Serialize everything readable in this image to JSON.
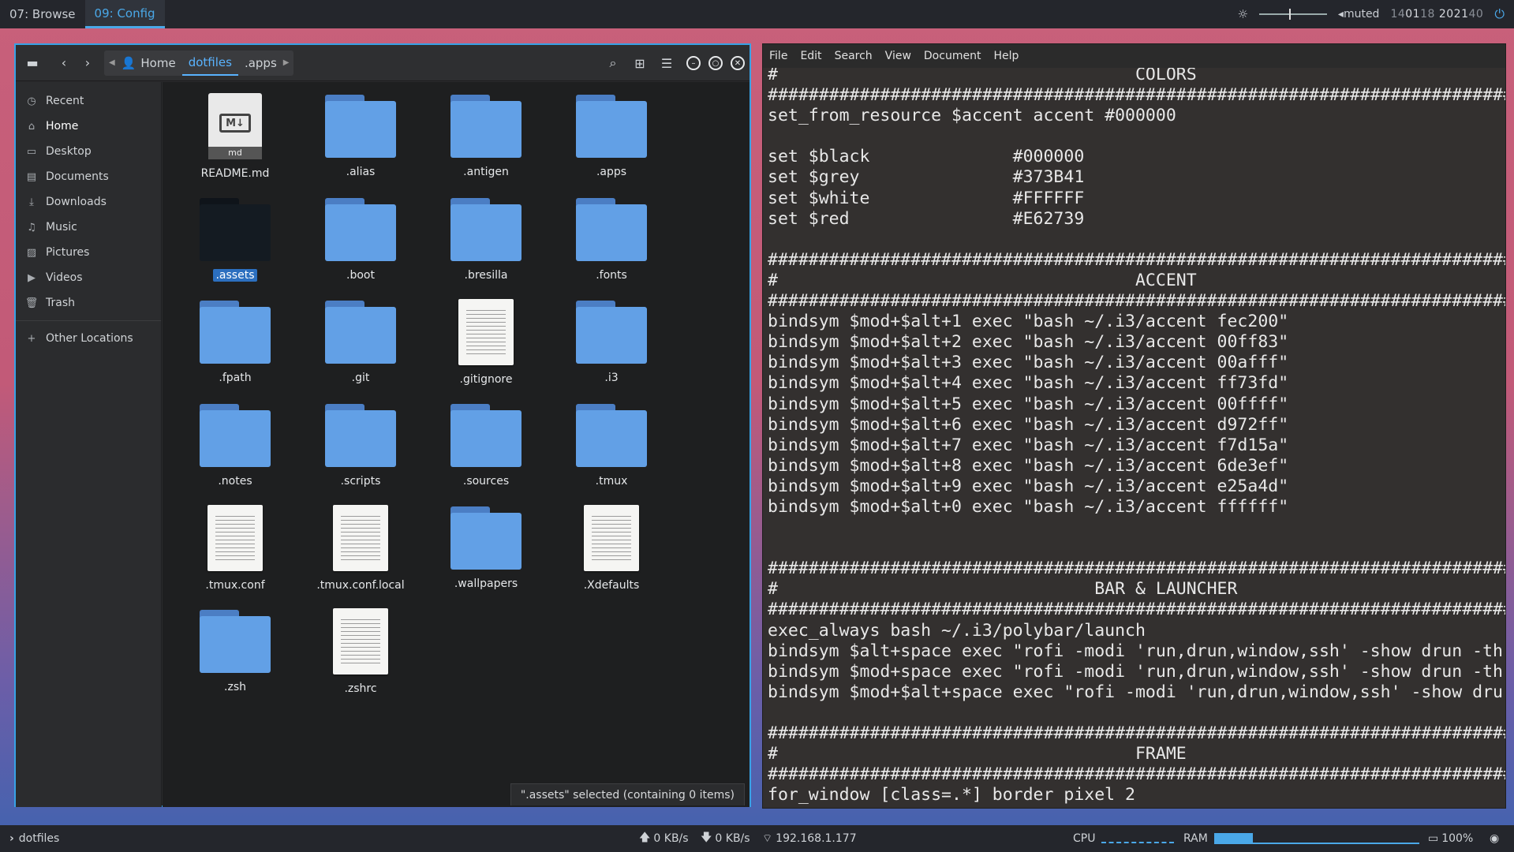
{
  "topbar": {
    "workspaces": [
      {
        "label": "07: Browse",
        "active": false
      },
      {
        "label": "09: Config",
        "active": true
      }
    ],
    "volume": "muted",
    "clock_dim_1": "14",
    "clock_1": "01",
    "clock_dim_2": "18",
    "clock_2": " 2021",
    "clock_dim_3": "40",
    "volume_level": 0.45,
    "accent_color": "#4aa8e8"
  },
  "file_manager": {
    "breadcrumbs": [
      "Home",
      "dotfiles",
      ".apps"
    ],
    "active_crumb": "dotfiles",
    "sidebar": [
      {
        "label": "Recent",
        "icon": "clock-icon"
      },
      {
        "label": "Home",
        "icon": "home-icon"
      },
      {
        "label": "Desktop",
        "icon": "desktop-icon"
      },
      {
        "label": "Documents",
        "icon": "document-icon"
      },
      {
        "label": "Downloads",
        "icon": "download-icon"
      },
      {
        "label": "Music",
        "icon": "music-icon"
      },
      {
        "label": "Pictures",
        "icon": "picture-icon"
      },
      {
        "label": "Videos",
        "icon": "video-icon"
      },
      {
        "label": "Trash",
        "icon": "trash-icon"
      }
    ],
    "other_locations": "Other Locations",
    "files": [
      {
        "name": "README.md",
        "type": "markdown"
      },
      {
        "name": ".alias",
        "type": "folder"
      },
      {
        "name": ".antigen",
        "type": "folder"
      },
      {
        "name": ".apps",
        "type": "folder"
      },
      {
        "name": ".assets",
        "type": "folder-selected"
      },
      {
        "name": ".boot",
        "type": "folder"
      },
      {
        "name": ".bresilla",
        "type": "folder"
      },
      {
        "name": ".fonts",
        "type": "folder"
      },
      {
        "name": ".fpath",
        "type": "folder"
      },
      {
        "name": ".git",
        "type": "folder"
      },
      {
        "name": ".gitignore",
        "type": "text"
      },
      {
        "name": ".i3",
        "type": "folder"
      },
      {
        "name": ".notes",
        "type": "folder"
      },
      {
        "name": ".scripts",
        "type": "folder"
      },
      {
        "name": ".sources",
        "type": "folder"
      },
      {
        "name": ".tmux",
        "type": "folder"
      },
      {
        "name": ".tmux.conf",
        "type": "text"
      },
      {
        "name": ".tmux.conf.local",
        "type": "text"
      },
      {
        "name": ".wallpapers",
        "type": "folder"
      },
      {
        "name": ".Xdefaults",
        "type": "text"
      },
      {
        "name": ".zsh",
        "type": "folder"
      },
      {
        "name": ".zshrc",
        "type": "text"
      }
    ],
    "md_badge": "md",
    "md_logo": "M↓",
    "status": "\".assets\" selected (containing 0 items)"
  },
  "editor": {
    "menus": [
      "File",
      "Edit",
      "Search",
      "View",
      "Document",
      "Help"
    ],
    "lines": [
      "#                                   COLORS",
      "##############################################################################",
      "set_from_resource $accent accent #000000",
      "",
      "set $black              #000000",
      "set $grey               #373B41",
      "set $white              #FFFFFF",
      "set $red                #E62739",
      "",
      "##############################################################################",
      "#                                   ACCENT",
      "##############################################################################",
      "bindsym $mod+$alt+1 exec \"bash ~/.i3/accent fec200\"",
      "bindsym $mod+$alt+2 exec \"bash ~/.i3/accent 00ff83\"",
      "bindsym $mod+$alt+3 exec \"bash ~/.i3/accent 00afff\"",
      "bindsym $mod+$alt+4 exec \"bash ~/.i3/accent ff73fd\"",
      "bindsym $mod+$alt+5 exec \"bash ~/.i3/accent 00ffff\"",
      "bindsym $mod+$alt+6 exec \"bash ~/.i3/accent d972ff\"",
      "bindsym $mod+$alt+7 exec \"bash ~/.i3/accent f7d15a\"",
      "bindsym $mod+$alt+8 exec \"bash ~/.i3/accent 6de3ef\"",
      "bindsym $mod+$alt+9 exec \"bash ~/.i3/accent e25a4d\"",
      "bindsym $mod+$alt+0 exec \"bash ~/.i3/accent ffffff\"",
      "",
      "",
      "##############################################################################",
      "#                               BAR & LAUNCHER",
      "##############################################################################",
      "exec_always bash ~/.i3/polybar/launch",
      "bindsym $alt+space exec \"rofi -modi 'run,drun,window,ssh' -show drun -th",
      "bindsym $mod+space exec \"rofi -modi 'run,drun,window,ssh' -show drun -th",
      "bindsym $mod+$alt+space exec \"rofi -modi 'run,drun,window,ssh' -show dru",
      "",
      "##############################################################################",
      "#                                   FRAME",
      "##############################################################################",
      "for_window [class=.*] border pixel 2"
    ]
  },
  "bottombar": {
    "directory": "dotfiles",
    "upload": "0 KB/s",
    "download": "0 KB/s",
    "ip": "192.168.1.177",
    "cpu_label": "CPU",
    "ram_label": "RAM",
    "ram_fraction": 0.19,
    "battery": "100%"
  }
}
